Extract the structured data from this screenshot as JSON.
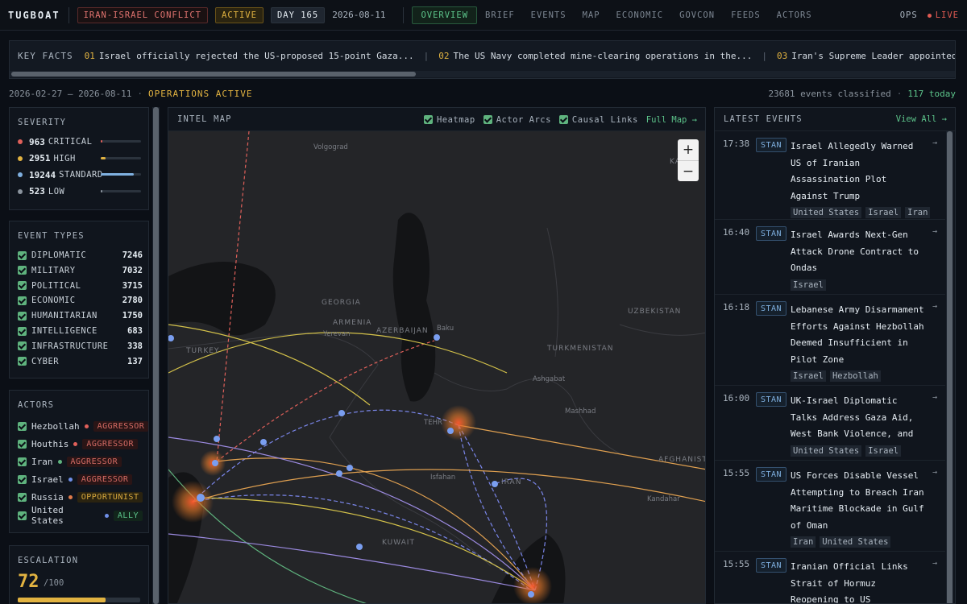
{
  "topbar": {
    "logo": "TUGBOAT",
    "conflict": "IRAN-ISRAEL CONFLICT",
    "status": "ACTIVE",
    "day": "DAY 165",
    "date": "2026-08-11",
    "nav": [
      "OVERVIEW",
      "BRIEF",
      "EVENTS",
      "MAP",
      "ECONOMIC",
      "GOVCON",
      "FEEDS",
      "ACTORS"
    ],
    "ops": "OPS",
    "live": "LIVE"
  },
  "key_facts": {
    "label": "KEY FACTS",
    "items": [
      {
        "num": "01",
        "text": "Israel officially rejected the US-proposed 15-point Gaza..."
      },
      {
        "num": "02",
        "text": "The US Navy completed mine-clearing operations in the..."
      },
      {
        "num": "03",
        "text": "Iran's Supreme Leader appointed six new senio"
      }
    ]
  },
  "status_line": {
    "range": "2026-02-27 – 2026-08-11",
    "ops": "OPERATIONS ACTIVE",
    "events_classified": "23681 events classified",
    "today": "117 today"
  },
  "severity": {
    "title": "SEVERITY",
    "rows": [
      {
        "count": "963",
        "label": "CRITICAL",
        "color": "#e0605a",
        "share": 0.04
      },
      {
        "count": "2951",
        "label": "HIGH",
        "color": "#e2b341",
        "share": 0.12
      },
      {
        "count": "19244",
        "label": "STANDARD",
        "color": "#7fb0e0",
        "share": 0.81
      },
      {
        "count": "523",
        "label": "LOW",
        "color": "#8b949e",
        "share": 0.02
      }
    ]
  },
  "event_types": {
    "title": "EVENT TYPES",
    "rows": [
      {
        "label": "DIPLOMATIC",
        "count": "7246"
      },
      {
        "label": "MILITARY",
        "count": "7032"
      },
      {
        "label": "POLITICAL",
        "count": "3715"
      },
      {
        "label": "ECONOMIC",
        "count": "2780"
      },
      {
        "label": "HUMANITARIAN",
        "count": "1750"
      },
      {
        "label": "INTELLIGENCE",
        "count": "683"
      },
      {
        "label": "INFRASTRUCTURE",
        "count": "338"
      },
      {
        "label": "CYBER",
        "count": "137"
      }
    ]
  },
  "actors": {
    "title": "ACTORS",
    "rows": [
      {
        "name": "Hezbollah",
        "dot": "#e0605a",
        "role": "AGGRESSOR",
        "role_kind": "aggressor"
      },
      {
        "name": "Houthis",
        "dot": "#e0605a",
        "role": "AGGRESSOR",
        "role_kind": "aggressor"
      },
      {
        "name": "Iran",
        "dot": "#5fb37e",
        "role": "AGGRESSOR",
        "role_kind": "aggressor"
      },
      {
        "name": "Israel",
        "dot": "#6f8fe8",
        "role": "AGGRESSOR",
        "role_kind": "aggressor"
      },
      {
        "name": "Russia",
        "dot": "#e07b4a",
        "role": "OPPORTUNIST",
        "role_kind": "opportunist"
      },
      {
        "name": "United States",
        "dot": "#6f8fe8",
        "role": "ALLY",
        "role_kind": "ally"
      }
    ]
  },
  "escalation": {
    "title": "ESCALATION",
    "value": "72",
    "max": "/100",
    "level": 0.72
  },
  "map": {
    "title": "INTEL MAP",
    "toggles": [
      "Heatmap",
      "Actor Arcs",
      "Causal Links"
    ],
    "full_map": "Full Map →",
    "zoom_in": "+",
    "zoom_out": "−",
    "labels": [
      "Volgograd",
      "GEORGIA",
      "ARMENIA",
      "AZERBAIJAN",
      "Yerevan",
      "Baku",
      "TURKEY",
      "TURKMENISTAN",
      "UZBEKISTAN",
      "Ashgabat",
      "Mashhad",
      "AFGHANISTAN",
      "Kandahar",
      "TEHR",
      "Isfahan",
      "IRAN",
      "KUWAIT",
      "KAZ"
    ]
  },
  "events": {
    "title": "LATEST EVENTS",
    "view_all": "View All →",
    "items": [
      {
        "time": "17:38",
        "source": "STAN",
        "title": "Israel Allegedly Warned US of Iranian Assassination Plot Against Trump",
        "tags": [
          "United States",
          "Israel",
          "Iran"
        ]
      },
      {
        "time": "16:40",
        "source": "STAN",
        "title": "Israel Awards Next-Gen Attack Drone Contract to Ondas",
        "tags": [
          "Israel"
        ]
      },
      {
        "time": "16:18",
        "source": "STAN",
        "title": "Lebanese Army Disarmament Efforts Against Hezbollah Deemed Insufficient in Pilot Zone",
        "tags": [
          "Israel",
          "Hezbollah"
        ]
      },
      {
        "time": "16:00",
        "source": "STAN",
        "title": "UK-Israel Diplomatic Talks Address Gaza Aid, West Bank Violence, and Iran",
        "tags": [
          "United States",
          "Israel"
        ]
      },
      {
        "time": "15:55",
        "source": "STAN",
        "title": "US Forces Disable Vessel Attempting to Breach Iran Maritime Blockade in Gulf of Oman",
        "tags": [
          "Iran",
          "United States"
        ]
      },
      {
        "time": "15:55",
        "source": "STAN",
        "title": "Iranian Official Links Strait of Hormuz Reopening to US Concessions",
        "tags": []
      }
    ]
  },
  "colors": {
    "accent_green": "#5cc38a",
    "accent_amber": "#e2b341",
    "critical_red": "#e0605a",
    "standard_blue": "#7fb0e0"
  }
}
